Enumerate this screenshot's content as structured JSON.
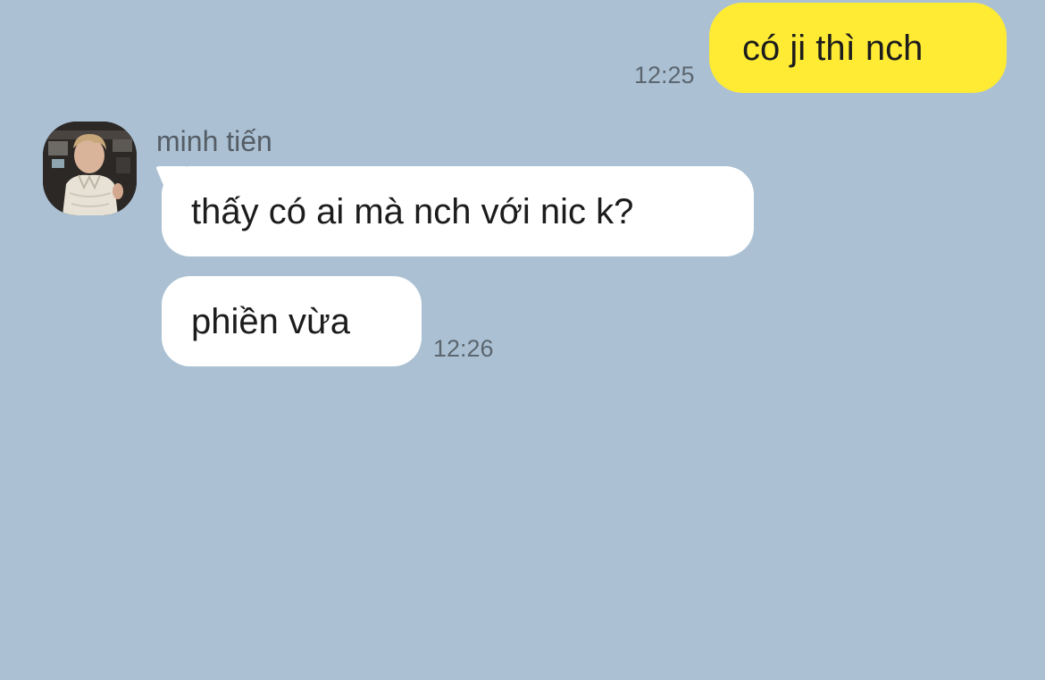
{
  "chat": {
    "messages": [
      {
        "direction": "outgoing",
        "text": "có ji thì nch",
        "time": "12:25"
      },
      {
        "direction": "incoming",
        "sender": "minh tiến",
        "text": "thấy có ai mà nch với nic k?"
      },
      {
        "direction": "incoming",
        "sender": "minh tiến",
        "text": "phiền vừa",
        "time": "12:26"
      }
    ]
  },
  "avatar": {
    "icon": "user-photo-avatar"
  },
  "colors": {
    "background": "#abc1d3",
    "outgoing_bubble": "#ffeb34",
    "incoming_bubble": "#ffffff",
    "text": "#1c1c1c",
    "muted": "#5b6670"
  }
}
